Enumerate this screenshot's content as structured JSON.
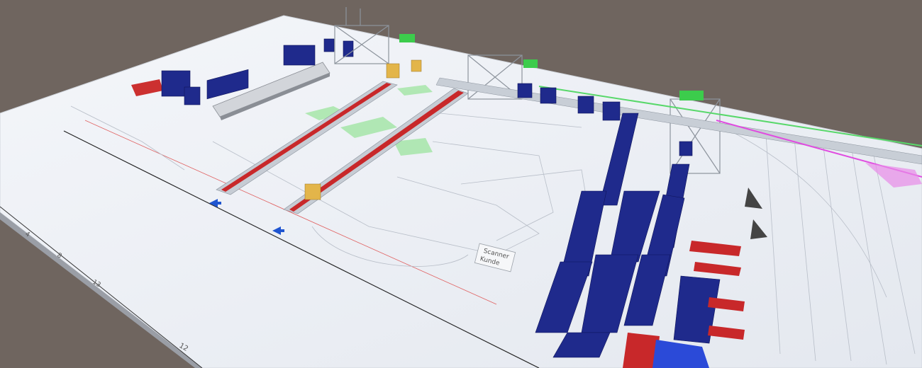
{
  "scene": {
    "background": "#6f655f",
    "floor_color": "#eef1f6",
    "equipment_blue": "#1f2a8c",
    "conveyor_red": "#c8282a",
    "frame_gray": "#a9b0b8",
    "accent_green": "#58d86a",
    "accent_magenta": "#e04ce0"
  },
  "annotations": {
    "scanner_label_line1": "Scanner",
    "scanner_label_line2": "Kunde",
    "grid_numbers": [
      "4",
      "8",
      "12",
      "13"
    ]
  }
}
